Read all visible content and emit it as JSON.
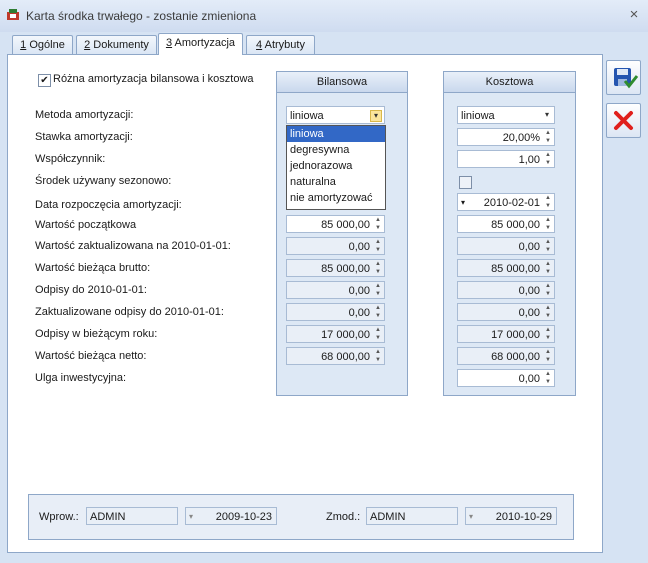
{
  "window": {
    "title": "Karta środka trwałego - zostanie zmieniona",
    "close": "×"
  },
  "tabs": [
    {
      "num": "1",
      "label": "Ogólne"
    },
    {
      "num": "2",
      "label": "Dokumenty"
    },
    {
      "num": "3",
      "label": "Amortyzacja"
    },
    {
      "num": "4",
      "label": "Atrybuty"
    }
  ],
  "checkbox_diff": {
    "label": "Różna amortyzacja bilansowa i kosztowa",
    "checked": "✔"
  },
  "columns": {
    "bilansowa": "Bilansowa",
    "kosztowa": "Kosztowa"
  },
  "labels": {
    "metoda": "Metoda amortyzacji:",
    "stawka": "Stawka amortyzacji:",
    "wspolczynnik": "Współczynnik:",
    "sezonowy": "Środek używany sezonowo:",
    "data_rozp": "Data rozpoczęcia amortyzacji:",
    "wartosc_pocz": "Wartość początkowa",
    "wartosc_zakt": "Wartość zaktualizowana na 2010-01-01:",
    "wartosc_brutto": "Wartość bieżąca brutto:",
    "odpisy_do": "Odpisy do 2010-01-01:",
    "zakt_odpisy": "Zaktualizowane odpisy do 2010-01-01:",
    "odpisy_rok": "Odpisy w bieżącym roku:",
    "wartosc_netto": "Wartość bieżąca netto:",
    "ulga": "Ulga inwestycyjna:"
  },
  "bilansowa": {
    "metoda": "liniowa",
    "wartosc_pocz": "85 000,00",
    "wartosc_zakt": "0,00",
    "wartosc_brutto": "85 000,00",
    "odpisy_do": "0,00",
    "zakt_odpisy": "0,00",
    "odpisy_rok": "17 000,00",
    "wartosc_netto": "68 000,00"
  },
  "dropdown_options": [
    "liniowa",
    "degresywna",
    "jednorazowa",
    "naturalna",
    "nie amortyzować"
  ],
  "kosztowa": {
    "metoda": "liniowa",
    "stawka": "20,00%",
    "wspolczynnik": "1,00",
    "data_rozp": "2010-02-01",
    "wartosc_pocz": "85 000,00",
    "wartosc_zakt": "0,00",
    "wartosc_brutto": "85 000,00",
    "odpisy_do": "0,00",
    "zakt_odpisy": "0,00",
    "odpisy_rok": "17 000,00",
    "wartosc_netto": "68 000,00",
    "ulga": "0,00"
  },
  "footer": {
    "wprow_label": "Wprow.:",
    "wprow_user": "ADMIN",
    "wprow_date": "2009-10-23",
    "zmod_label": "Zmod.:",
    "zmod_user": "ADMIN",
    "zmod_date": "2010-10-29"
  },
  "icons": {
    "save": "save-icon",
    "cancel": "cancel-icon"
  },
  "colors": {
    "selection": "#3268c6",
    "cancel_red": "#e0201c",
    "save_blue": "#2455b0"
  }
}
